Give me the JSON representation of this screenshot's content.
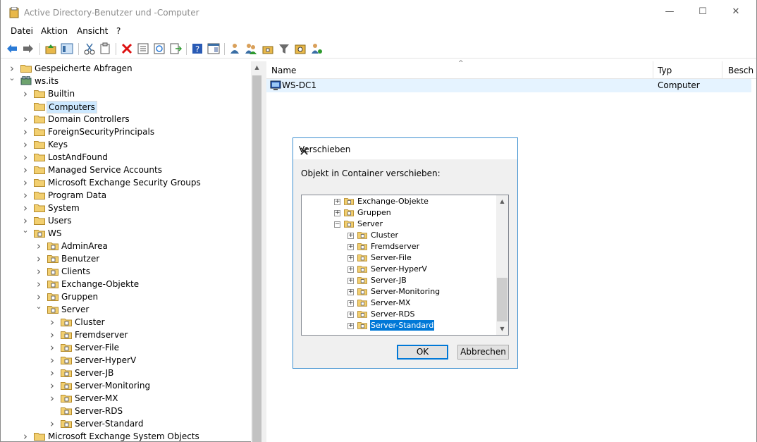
{
  "window": {
    "title": "Active Directory-Benutzer und -Computer",
    "minimize": "—",
    "maximize": "☐",
    "close": "✕"
  },
  "menu": [
    "Datei",
    "Aktion",
    "Ansicht",
    "?"
  ],
  "tree": {
    "items": [
      {
        "label": "Gespeicherte Abfragen",
        "depth": 1,
        "expand": "collapsed"
      },
      {
        "label": "ws.its",
        "depth": 1,
        "expand": "expanded",
        "icon": "domain"
      },
      {
        "label": "Builtin",
        "depth": 2,
        "expand": "collapsed"
      },
      {
        "label": "Computers",
        "depth": 2,
        "expand": "none",
        "selected": true
      },
      {
        "label": "Domain Controllers",
        "depth": 2,
        "expand": "collapsed"
      },
      {
        "label": "ForeignSecurityPrincipals",
        "depth": 2,
        "expand": "collapsed"
      },
      {
        "label": "Keys",
        "depth": 2,
        "expand": "collapsed"
      },
      {
        "label": "LostAndFound",
        "depth": 2,
        "expand": "collapsed"
      },
      {
        "label": "Managed Service Accounts",
        "depth": 2,
        "expand": "collapsed"
      },
      {
        "label": "Microsoft Exchange Security Groups",
        "depth": 2,
        "expand": "collapsed"
      },
      {
        "label": "Program Data",
        "depth": 2,
        "expand": "collapsed"
      },
      {
        "label": "System",
        "depth": 2,
        "expand": "collapsed"
      },
      {
        "label": "Users",
        "depth": 2,
        "expand": "collapsed"
      },
      {
        "label": "WS",
        "depth": 2,
        "expand": "expanded",
        "icon": "ou"
      },
      {
        "label": "AdminArea",
        "depth": 3,
        "expand": "collapsed",
        "icon": "ou"
      },
      {
        "label": "Benutzer",
        "depth": 3,
        "expand": "collapsed",
        "icon": "ou"
      },
      {
        "label": "Clients",
        "depth": 3,
        "expand": "collapsed",
        "icon": "ou"
      },
      {
        "label": "Exchange-Objekte",
        "depth": 3,
        "expand": "collapsed",
        "icon": "ou"
      },
      {
        "label": "Gruppen",
        "depth": 3,
        "expand": "collapsed",
        "icon": "ou"
      },
      {
        "label": "Server",
        "depth": 3,
        "expand": "expanded",
        "icon": "ou"
      },
      {
        "label": "Cluster",
        "depth": 4,
        "expand": "collapsed",
        "icon": "ou"
      },
      {
        "label": "Fremdserver",
        "depth": 4,
        "expand": "collapsed",
        "icon": "ou"
      },
      {
        "label": "Server-File",
        "depth": 4,
        "expand": "collapsed",
        "icon": "ou"
      },
      {
        "label": "Server-HyperV",
        "depth": 4,
        "expand": "collapsed",
        "icon": "ou"
      },
      {
        "label": "Server-JB",
        "depth": 4,
        "expand": "collapsed",
        "icon": "ou"
      },
      {
        "label": "Server-Monitoring",
        "depth": 4,
        "expand": "collapsed",
        "icon": "ou"
      },
      {
        "label": "Server-MX",
        "depth": 4,
        "expand": "collapsed",
        "icon": "ou"
      },
      {
        "label": "Server-RDS",
        "depth": 4,
        "expand": "none",
        "icon": "ou"
      },
      {
        "label": "Server-Standard",
        "depth": 4,
        "expand": "collapsed",
        "icon": "ou"
      },
      {
        "label": "Microsoft Exchange System Objects",
        "depth": 2,
        "expand": "collapsed"
      }
    ]
  },
  "list": {
    "headers": {
      "name": "Name",
      "type": "Typ",
      "desc": "Besch"
    },
    "rows": [
      {
        "name": "WS-DC1",
        "type": "Computer"
      }
    ]
  },
  "dialog": {
    "title": "Verschieben",
    "close": "✕",
    "prompt": "Objekt in Container verschieben:",
    "ok": "OK",
    "cancel": "Abbrechen",
    "tree": [
      {
        "label": "Exchange-Objekte",
        "depth": 0,
        "pm": "+"
      },
      {
        "label": "Gruppen",
        "depth": 0,
        "pm": "+"
      },
      {
        "label": "Server",
        "depth": 0,
        "pm": "−"
      },
      {
        "label": "Cluster",
        "depth": 1,
        "pm": "+"
      },
      {
        "label": "Fremdserver",
        "depth": 1,
        "pm": "+"
      },
      {
        "label": "Server-File",
        "depth": 1,
        "pm": "+"
      },
      {
        "label": "Server-HyperV",
        "depth": 1,
        "pm": "+"
      },
      {
        "label": "Server-JB",
        "depth": 1,
        "pm": "+"
      },
      {
        "label": "Server-Monitoring",
        "depth": 1,
        "pm": "+"
      },
      {
        "label": "Server-MX",
        "depth": 1,
        "pm": "+"
      },
      {
        "label": "Server-RDS",
        "depth": 1,
        "pm": "+"
      },
      {
        "label": "Server-Standard",
        "depth": 1,
        "pm": "+",
        "selected": true
      }
    ]
  },
  "colors": {
    "accent": "#0078d7",
    "selection": "#cce8ff",
    "folder": "#e8b84a"
  }
}
